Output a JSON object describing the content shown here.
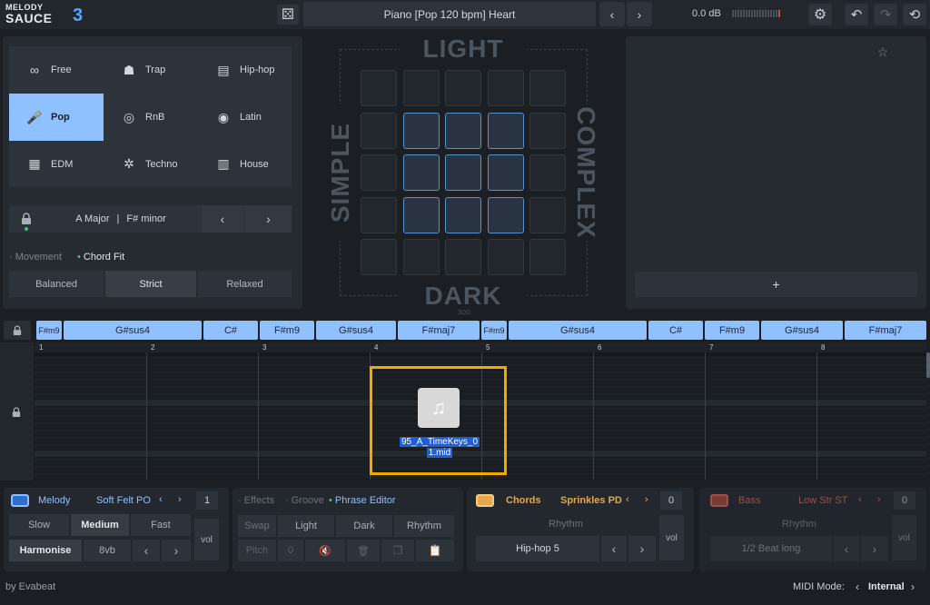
{
  "app": {
    "logo_line1": "MELODY",
    "logo_line2": "SAUCE",
    "logo_version": "3",
    "brand": "by Evabeat"
  },
  "topbar": {
    "preset": "Piano  [Pop 120 bpm]  Heart",
    "volume": "0.0 dB",
    "prev": "‹",
    "next": "›",
    "dice": "⚄",
    "gear": "⚙",
    "undo": "↶",
    "redo": "↷",
    "history": "⟲"
  },
  "genres": [
    {
      "label": "Free",
      "icon": "infinity-icon",
      "glyph": "∞"
    },
    {
      "label": "Trap",
      "icon": "hoodie-icon",
      "glyph": "☗"
    },
    {
      "label": "Hip-hop",
      "icon": "boombox-icon",
      "glyph": "▤"
    },
    {
      "label": "Pop",
      "icon": "microphone-icon",
      "glyph": "🎤",
      "selected": true
    },
    {
      "label": "RnB",
      "icon": "vinyl-icon",
      "glyph": "◎"
    },
    {
      "label": "Latin",
      "icon": "speaker-icon",
      "glyph": "◉"
    },
    {
      "label": "EDM",
      "icon": "keyboard-icon",
      "glyph": "▦"
    },
    {
      "label": "Techno",
      "icon": "butterfly-icon",
      "glyph": "✲"
    },
    {
      "label": "House",
      "icon": "piano-icon",
      "glyph": "▥"
    }
  ],
  "key": {
    "major": "A Major",
    "sep": "|",
    "minor": "F# minor",
    "prev": "‹",
    "next": "›"
  },
  "movement": {
    "movement_label": "Movement",
    "chordfit_label": "Chord Fit",
    "options": [
      "Balanced",
      "Strict",
      "Relaxed"
    ],
    "selected": "Strict"
  },
  "grid": {
    "top": "LIGHT",
    "bottom": "DARK",
    "left": "SIMPLE",
    "right": "COMPLEX",
    "sub": "3DD"
  },
  "favorites": {
    "add": "+",
    "star": "☆"
  },
  "chords": [
    {
      "label": "F#m9",
      "small": true
    },
    {
      "label": "G#sus4"
    },
    {
      "label": "C#"
    },
    {
      "label": "F#m9"
    },
    {
      "label": "G#sus4"
    },
    {
      "label": "F#maj7"
    },
    {
      "label": "F#m9",
      "small": true
    },
    {
      "label": "G#sus4"
    },
    {
      "label": "C#"
    },
    {
      "label": "F#m9"
    },
    {
      "label": "G#sus4"
    },
    {
      "label": "F#maj7"
    }
  ],
  "ruler": [
    "1",
    "2",
    "3",
    "4",
    "5",
    "6",
    "7",
    "8"
  ],
  "drag": {
    "filename_line1": "95_A_TimeKeys_0",
    "filename_line2": "1.mid"
  },
  "melody": {
    "title": "Melody",
    "preset": "Soft Felt PO",
    "octave": "1",
    "speed": [
      "Slow",
      "Medium",
      "Fast"
    ],
    "speed_selected": "Medium",
    "harmonise": "Harmonise",
    "vb": "8vb",
    "vol": "vol"
  },
  "effects": {
    "tabs": [
      "Effects",
      "Groove",
      "Phrase Editor"
    ],
    "active": "Phrase Editor",
    "row1": [
      "Swap",
      "Light",
      "Dark",
      "Rhythm"
    ],
    "pitch": "Pitch",
    "pitch_val": "0"
  },
  "chords_sec": {
    "title": "Chords",
    "preset": "Sprinkles PD",
    "octave": "0",
    "rhythm": "Rhythm",
    "pattern": "Hip-hop 5",
    "vol": "vol"
  },
  "bass": {
    "title": "Bass",
    "preset": "Low Str ST",
    "octave": "0",
    "rhythm": "Rhythm",
    "pattern": "1/2 Beat long",
    "vol": "vol"
  },
  "footer": {
    "midi_label": "MIDI Mode:",
    "midi_value": "Internal"
  },
  "colors": {
    "accent": "#8fc0ff",
    "chords": "#e8a64a",
    "bass": "#c0504a",
    "drag_box": "#f2a900"
  }
}
